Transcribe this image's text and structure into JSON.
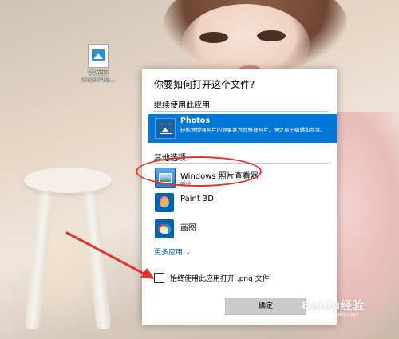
{
  "desktop": {
    "icon_label_line1": "QQ截图",
    "icon_label_line2": "20190402...",
    "watermark": "Baidu经验",
    "watermark_sub": "jingyan.baidu.com"
  },
  "dialog": {
    "title": "你要如何打开这个文件?",
    "continue_label": "继续使用此应用",
    "selected_app": {
      "name": "Photos",
      "description": "轻松地增强照片的效果并为你整理照片，便之易于编辑和共享。"
    },
    "other_options_label": "其他选项",
    "apps": [
      {
        "name": "Windows 照片查看器",
        "sub": "新增"
      },
      {
        "name": "Paint 3D",
        "sub": ""
      },
      {
        "name": "画图",
        "sub": ""
      }
    ],
    "more_apps_label": "更多应用 ↓",
    "always_use_label": "始终使用此应用打开 .png 文件",
    "always_use_checked": false,
    "ok_label": "确定"
  },
  "colors": {
    "accent": "#0078d7",
    "annotation": "#e2332f",
    "link": "#0063b1"
  }
}
